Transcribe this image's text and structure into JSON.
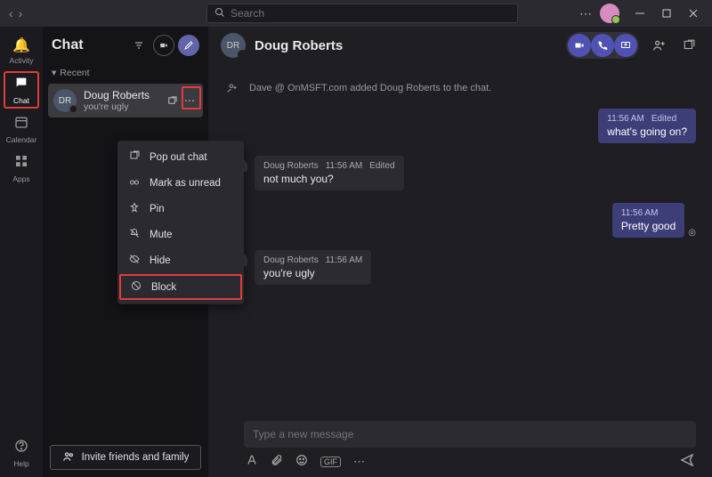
{
  "titlebar": {
    "search_placeholder": "Search"
  },
  "rail": {
    "activity": {
      "label": "Activity"
    },
    "chat": {
      "label": "Chat"
    },
    "calendar": {
      "label": "Calendar"
    },
    "apps": {
      "label": "Apps"
    },
    "help": {
      "label": "Help"
    }
  },
  "sidebar": {
    "title": "Chat",
    "recent_label": "Recent",
    "items": [
      {
        "initials": "DR",
        "name": "Doug Roberts",
        "preview": "you're ugly"
      }
    ],
    "invite_label": "Invite friends and family"
  },
  "context_menu": {
    "pop_out": "Pop out chat",
    "mark_unread": "Mark as unread",
    "pin": "Pin",
    "mute": "Mute",
    "hide": "Hide",
    "block": "Block"
  },
  "chat": {
    "header_initials": "DR",
    "header_name": "Doug Roberts",
    "system_message": "Dave @ OnMSFT.com added Doug Roberts to the chat.",
    "messages": [
      {
        "side": "right",
        "time": "11:56 AM",
        "edited": "Edited",
        "text": "what's going on?"
      },
      {
        "side": "left",
        "author": "Doug Roberts",
        "time": "11:56 AM",
        "edited": "Edited",
        "text": "not much you?"
      },
      {
        "side": "right",
        "time": "11:56 AM",
        "text": "Pretty good"
      },
      {
        "side": "left",
        "author": "Doug Roberts",
        "time": "11:56 AM",
        "text": "you're ugly"
      }
    ],
    "compose_placeholder": "Type a new message"
  }
}
